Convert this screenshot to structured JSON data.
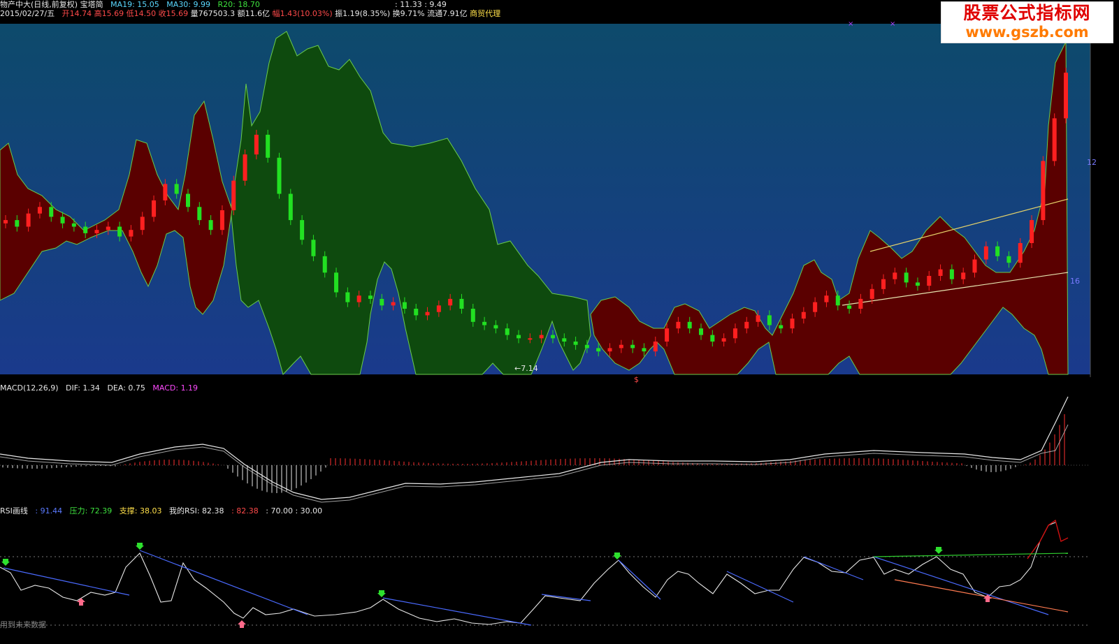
{
  "header": {
    "stock": "物产中大(日线,前复权) 宝塔简",
    "ma19": "MA19: 15.05",
    "ma30": "MA30: 9.99",
    "r20": "R20: 18.70",
    "extra": ": 11.33 : 9.49",
    "date": "2015/02/27/五",
    "open": "开14.74",
    "high": "高15.69",
    "low": "低14.50",
    "close": "收15.69",
    "volume": "量767503.3",
    "amount": "额11.6亿",
    "change": "幅1.43(10.03%)",
    "amplitude": "振1.19(8.35%)",
    "turnover": "换9.71%",
    "float": "流通7.91亿",
    "industry": "商贸代理"
  },
  "badge": {
    "line1": "股票公式指标网",
    "line2": "www.gszb.com"
  },
  "main_panel": {
    "low_label": "←7.14",
    "axis_right_top": "12",
    "axis_right_low": "16",
    "marker": "$"
  },
  "macd_panel": {
    "title": "MACD(12,26,9)",
    "dif": "DIF: 1.34",
    "dea": "DEA: 0.75",
    "macd": "MACD: 1.19"
  },
  "rsi_panel": {
    "title": "RSI画线",
    "v1": ": 91.44",
    "pressure": "压力: 72.39",
    "support": "支撑: 38.03",
    "myrsi_label": "我的RSI: 82.38",
    "myrsi_val": ": 82.38",
    "levels": ": 70.00 : 30.00",
    "footer": "用到未来数据"
  },
  "colors": {
    "up": "#ff2020",
    "down": "#22e022",
    "maroon": "#5a0000",
    "green_band": "#0e4a0e",
    "bg_top": "#0d4a6b",
    "bg_bottom": "#1a3a8c"
  },
  "chart_data": [
    {
      "type": "candlestick",
      "title": "物产中大(日线,前复权)",
      "ma19": 15.05,
      "ma30": 9.99,
      "r20": 18.7,
      "last_close": 15.69,
      "labeled_low": 7.14,
      "close_series": [
        11.2,
        11.0,
        11.4,
        11.6,
        11.3,
        11.1,
        11.0,
        10.8,
        10.9,
        11.0,
        10.7,
        10.9,
        11.3,
        11.8,
        12.3,
        12.0,
        11.6,
        11.2,
        10.9,
        11.5,
        12.4,
        13.2,
        13.8,
        13.1,
        12.0,
        11.2,
        10.6,
        10.1,
        9.6,
        9.0,
        8.7,
        8.9,
        8.8,
        8.6,
        8.7,
        8.5,
        8.3,
        8.4,
        8.6,
        8.8,
        8.5,
        8.1,
        8.0,
        7.9,
        7.7,
        7.6,
        7.6,
        7.7,
        7.6,
        7.5,
        7.4,
        7.3,
        7.2,
        7.3,
        7.4,
        7.3,
        7.2,
        7.5,
        7.9,
        8.1,
        7.9,
        7.7,
        7.5,
        7.6,
        7.9,
        8.1,
        8.3,
        8.0,
        7.9,
        8.2,
        8.4,
        8.7,
        8.9,
        8.6,
        8.5,
        8.8,
        9.1,
        9.4,
        9.6,
        9.3,
        9.2,
        9.5,
        9.7,
        9.4,
        9.6,
        10.0,
        10.4,
        10.1,
        9.9,
        10.5,
        11.2,
        13.0,
        14.3,
        15.69
      ]
    },
    {
      "type": "line",
      "title": "MACD(12,26,9)",
      "dif": 1.34,
      "dea": 0.75,
      "macd": 1.19
    },
    {
      "type": "line",
      "title": "RSI画线",
      "rsi": 91.44,
      "pressure": 72.39,
      "support": 38.03,
      "my_rsi": 82.38,
      "levels": [
        70,
        30
      ]
    }
  ]
}
